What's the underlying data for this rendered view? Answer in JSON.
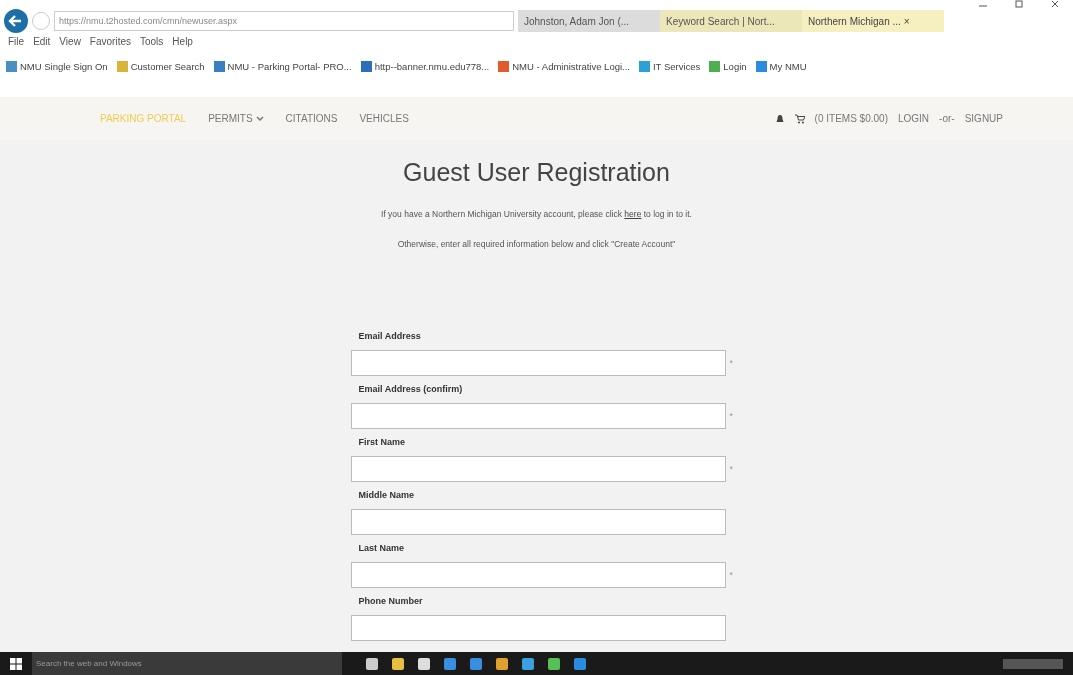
{
  "browser": {
    "url": "https://nmu.t2hosted.com/cmn/newuser.aspx",
    "tabs": [
      {
        "label": "Johnston, Adam Jon (...",
        "selected": false
      },
      {
        "label": "Keyword Search | Nort...",
        "selected": false
      },
      {
        "label": "Northern Michigan ...",
        "selected": true,
        "close": "×"
      }
    ],
    "menu": [
      "File",
      "Edit",
      "View",
      "Favorites",
      "Tools",
      "Help"
    ],
    "favorites": [
      "NMU Single Sign On",
      "Customer Search",
      "NMU - Parking Portal- PRO...",
      "http--banner.nmu.edu778...",
      "NMU - Administrative Logi...",
      "IT Services",
      "Login",
      "My NMU"
    ]
  },
  "nav": {
    "items": [
      {
        "label": "PARKING PORTAL",
        "selected": true
      },
      {
        "label": "PERMITS",
        "selected": false,
        "dropdown": true
      },
      {
        "label": "CITATIONS",
        "selected": false
      },
      {
        "label": "VEHICLES",
        "selected": false
      }
    ],
    "cart": "(0 ITEMS $0.00)",
    "login": "LOGIN",
    "or": "-or-",
    "signup": "SIGNUP"
  },
  "page": {
    "title": "Guest User Registration",
    "intro_before": "If you have a Northern Michigan University account, please click",
    "intro_link": "here",
    "intro_after": "to log in to it.",
    "instructions": "Otherwise, enter all required information below and click \"Create Account\"",
    "fields": [
      {
        "label": "Email Address",
        "required": true
      },
      {
        "label": "Email Address (confirm)",
        "required": true
      },
      {
        "label": "First Name",
        "required": true
      },
      {
        "label": "Middle Name",
        "required": false
      },
      {
        "label": "Last Name",
        "required": true
      },
      {
        "label": "Phone Number",
        "required": false
      }
    ],
    "required_mark": "*"
  },
  "taskbar": {
    "search_placeholder": "Search the web and Windows"
  }
}
